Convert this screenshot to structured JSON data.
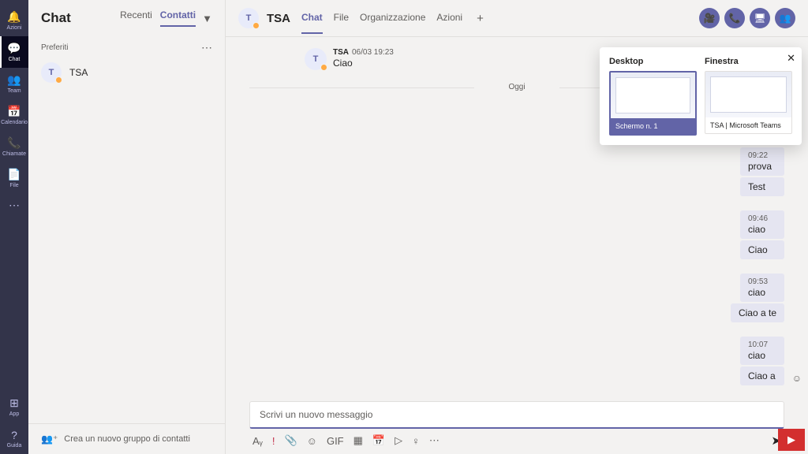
{
  "rail": {
    "items": [
      {
        "icon": "🔔",
        "label": "Azioni"
      },
      {
        "icon": "💬",
        "label": "Chat"
      },
      {
        "icon": "👥",
        "label": "Team"
      },
      {
        "icon": "📅",
        "label": "Calendario"
      },
      {
        "icon": "📞",
        "label": "Chiamate"
      },
      {
        "icon": "📄",
        "label": "File"
      }
    ],
    "more": "⋯",
    "app": {
      "icon": "⊞",
      "label": "App"
    },
    "help": {
      "icon": "?",
      "label": "Guida"
    }
  },
  "sidebar": {
    "title": "Chat",
    "tabs": {
      "recent": "Recenti",
      "contacts": "Contatti"
    },
    "section": "Preferiti",
    "contact": {
      "initial": "T",
      "name": "TSA"
    },
    "footer": "Crea un nuovo gruppo di contatti"
  },
  "chat": {
    "avatar": "T",
    "title": "TSA",
    "tabs": {
      "chat": "Chat",
      "file": "File",
      "org": "Organizzazione",
      "actions": "Azioni"
    },
    "message": {
      "sender": "TSA",
      "timestamp": "06/03 19:23",
      "text": "Ciao"
    },
    "divider": "Oggi",
    "groups": [
      {
        "time": "09:22",
        "msgs": [
          "prova",
          "Test"
        ]
      },
      {
        "time": "09:46",
        "msgs": [
          "ciao",
          "Ciao"
        ]
      },
      {
        "time": "09:53",
        "msgs": [
          "ciao",
          "Ciao a te"
        ]
      },
      {
        "time": "10:07",
        "msgs": [
          "ciao",
          "Ciao a"
        ]
      }
    ],
    "compose_placeholder": "Scrivi un nuovo messaggio"
  },
  "share": {
    "desktop": "Desktop",
    "window": "Finestra",
    "screen_label": "Schermo n. 1",
    "window_label": "TSA | Microsoft Teams"
  }
}
